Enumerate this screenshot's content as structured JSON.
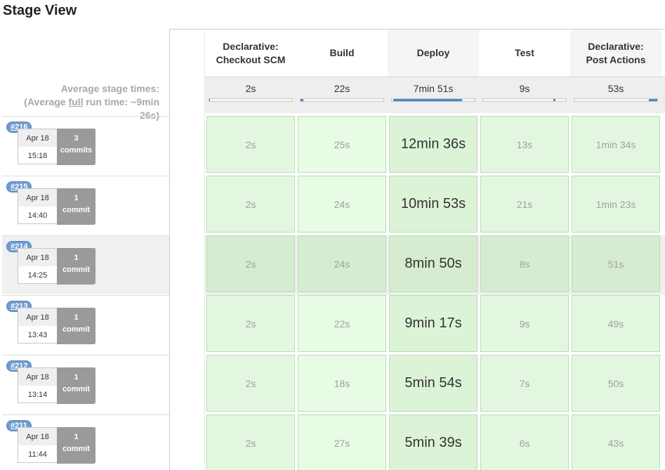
{
  "title": "Stage View",
  "average": {
    "line1": "Average stage times:",
    "line2_prefix": "(Average ",
    "line2_underlined": "full",
    "line2_suffix": " run time: ~9min",
    "line3": "26s)"
  },
  "stages": [
    {
      "name_line1": "Declarative:",
      "name_line2": "Checkout SCM",
      "avg": "2s",
      "avg_fraction_start": 0.0,
      "avg_fraction": 0.0
    },
    {
      "name_line1": "Build",
      "name_line2": "",
      "avg": "22s",
      "avg_fraction_start": 0.0,
      "avg_fraction": 0.03
    },
    {
      "name_line1": "Deploy",
      "name_line2": "",
      "avg": "7min 51s",
      "avg_fraction_start": 0.02,
      "avg_fraction": 0.83
    },
    {
      "name_line1": "Test",
      "name_line2": "",
      "avg": "9s",
      "avg_fraction_start": 0.85,
      "avg_fraction": 0.02
    },
    {
      "name_line1": "Declarative:",
      "name_line2": "Post Actions",
      "avg": "53s",
      "avg_fraction_start": 0.9,
      "avg_fraction": 0.1
    }
  ],
  "runs": [
    {
      "build": "#216",
      "date": "Apr 18",
      "time": "15:18",
      "commits_n": "3",
      "commits_word": "commits",
      "times": [
        "2s",
        "25s",
        "12min 36s",
        "13s",
        "1min 34s"
      ]
    },
    {
      "build": "#215",
      "date": "Apr 18",
      "time": "14:40",
      "commits_n": "1",
      "commits_word": "commit",
      "times": [
        "2s",
        "24s",
        "10min 53s",
        "21s",
        "1min 23s"
      ]
    },
    {
      "build": "#214",
      "date": "Apr 18",
      "time": "14:25",
      "commits_n": "1",
      "commits_word": "commit",
      "times": [
        "2s",
        "24s",
        "8min 50s",
        "8s",
        "51s"
      ]
    },
    {
      "build": "#213",
      "date": "Apr 18",
      "time": "13:43",
      "commits_n": "1",
      "commits_word": "commit",
      "times": [
        "2s",
        "22s",
        "9min 17s",
        "9s",
        "49s"
      ]
    },
    {
      "build": "#212",
      "date": "Apr 18",
      "time": "13:14",
      "commits_n": "1",
      "commits_word": "commit",
      "times": [
        "2s",
        "18s",
        "5min 54s",
        "7s",
        "50s"
      ]
    },
    {
      "build": "#211",
      "date": "Apr 18",
      "time": "11:44",
      "commits_n": "1",
      "commits_word": "commit",
      "times": [
        "2s",
        "27s",
        "5min 39s",
        "6s",
        "43s"
      ]
    }
  ],
  "highlighted_run_index": 2,
  "colors": {
    "success": "#e3f7e0",
    "bar": "#4a86c8",
    "badge": "#6f9bd0"
  }
}
